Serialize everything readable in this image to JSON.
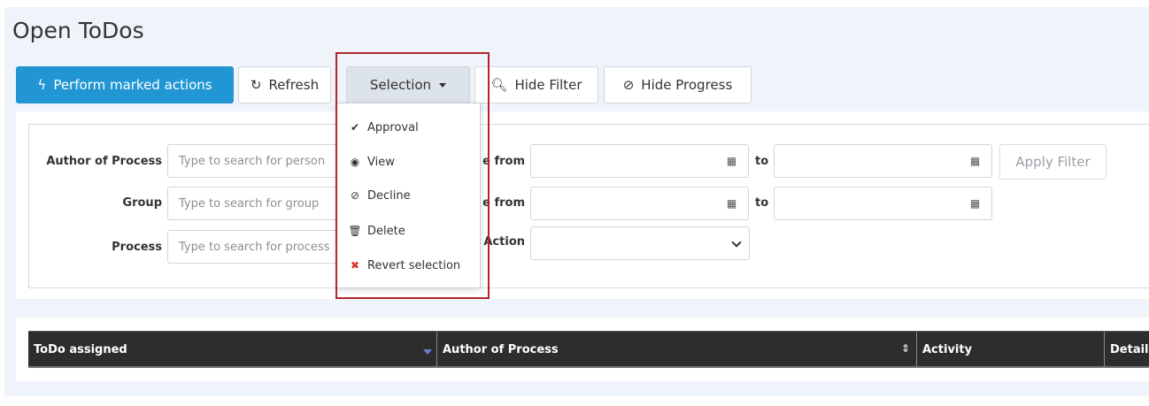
{
  "page": {
    "title": "Open ToDos"
  },
  "toolbar": {
    "perform_label": "Perform marked actions",
    "refresh_label": "Refresh",
    "selection_label": "Selection",
    "hide_filter_label": "Hide Filter",
    "hide_progress_label": "Hide Progress"
  },
  "selection_menu": {
    "items": [
      {
        "label": "Approval",
        "icon": "check-icon"
      },
      {
        "label": "View",
        "icon": "eye-icon"
      },
      {
        "label": "Decline",
        "icon": "ban-icon"
      },
      {
        "label": "Delete",
        "icon": "trash-icon"
      },
      {
        "label": "Revert selection",
        "icon": "close-icon",
        "color": "#d9342b"
      }
    ]
  },
  "filter": {
    "author_label": "Author of Process",
    "author_placeholder": "Type to search for person",
    "group_label": "Group",
    "group_placeholder": "Type to search for group",
    "process_label": "Process",
    "process_placeholder": "Type to search for process",
    "date1_label": "e from",
    "date2_label": "e from",
    "to_label": "to",
    "action_label": "Action",
    "apply_label": "Apply Filter"
  },
  "table": {
    "columns": [
      "ToDo assigned",
      "Author of Process",
      "Activity",
      "Detail"
    ]
  },
  "colors": {
    "primary": "#2196d3",
    "highlight": "#b2232e",
    "header_bg": "#2d2d2d"
  }
}
